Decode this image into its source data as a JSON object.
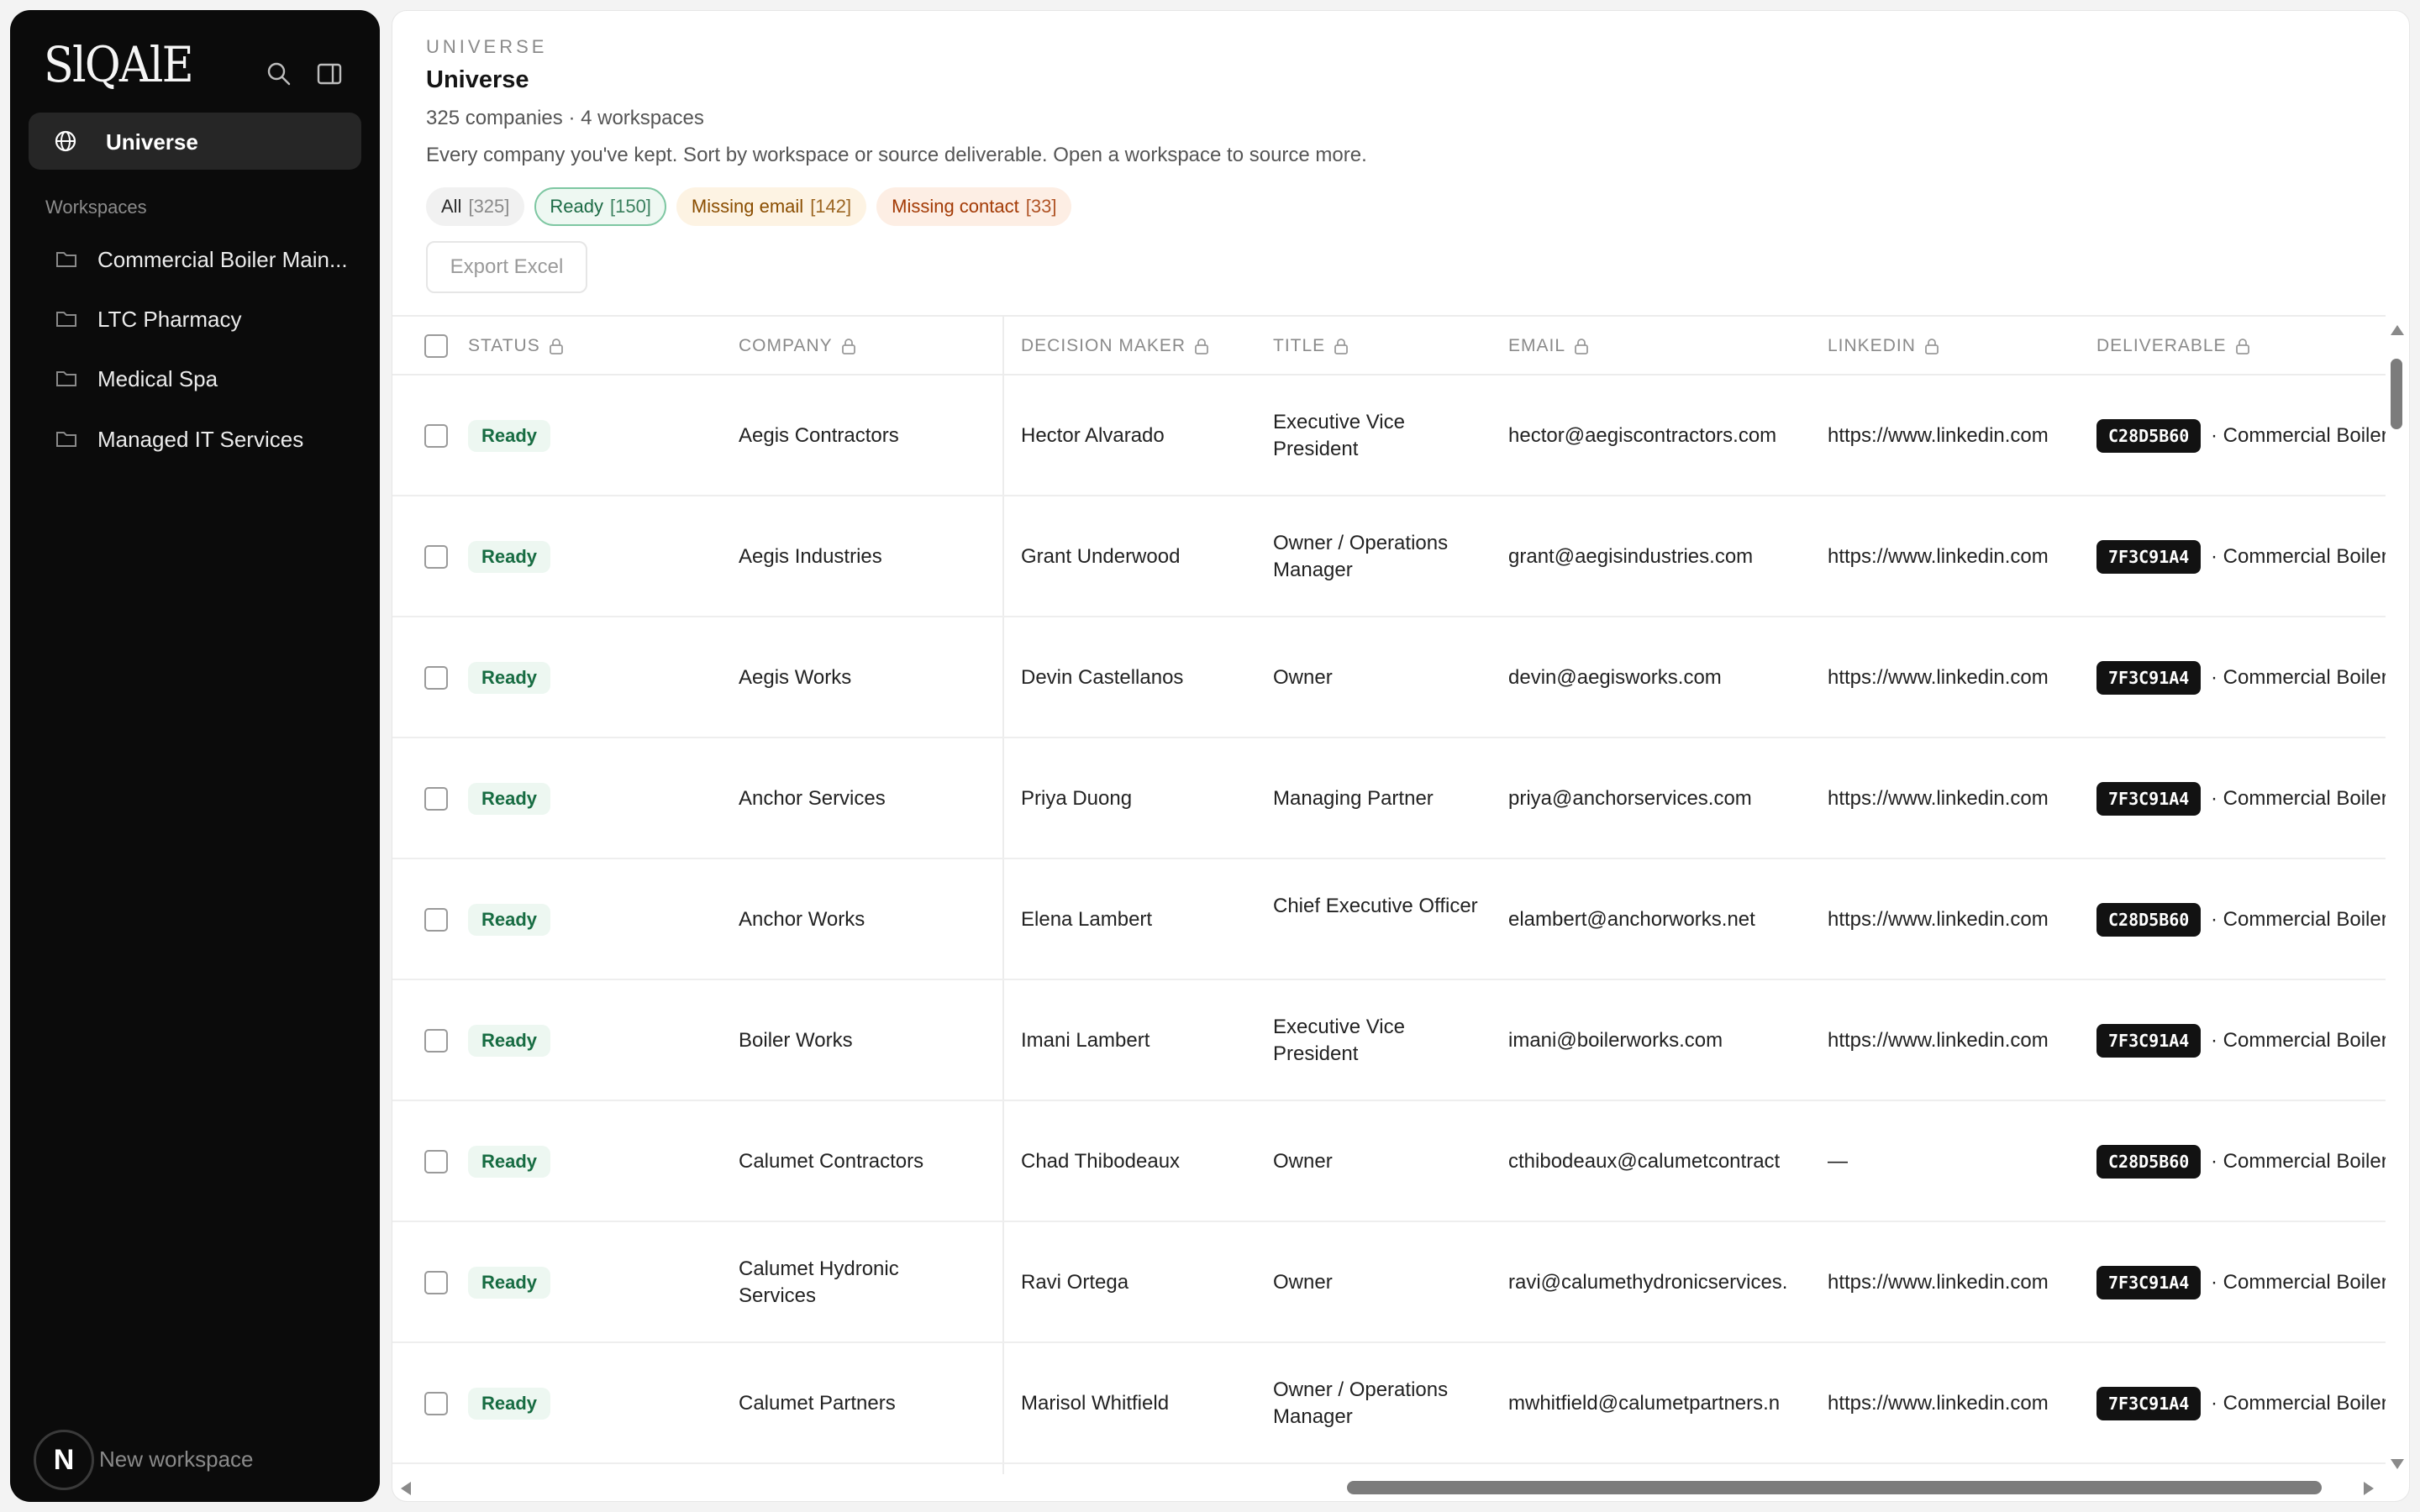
{
  "app": {
    "logo_text": "SlQAlE"
  },
  "sidebar": {
    "search_icon": "search-icon",
    "panel_icon": "sidebar-toggle-icon",
    "universe_label": "Universe",
    "workspaces_heading": "Workspaces",
    "workspaces": [
      {
        "label": "Commercial Boiler Main..."
      },
      {
        "label": "LTC Pharmacy"
      },
      {
        "label": "Medical Spa"
      },
      {
        "label": "Managed IT Services"
      }
    ],
    "new_workspace": "New workspace",
    "avatar_initial": "N"
  },
  "header": {
    "eyebrow": "UNIVERSE",
    "title": "Universe",
    "meta": "325 companies · 4 workspaces",
    "description": "Every company you've kept. Sort by workspace or source deliverable. Open a workspace to source more.",
    "filters": [
      {
        "label": "All",
        "count": "[325]"
      },
      {
        "label": "Ready",
        "count": "[150]"
      },
      {
        "label": "Missing email",
        "count": "[142]"
      },
      {
        "label": "Missing contact",
        "count": "[33]"
      }
    ],
    "export_label": "Export Excel"
  },
  "table": {
    "columns": [
      "STATUS",
      "COMPANY",
      "DECISION MAKER",
      "TITLE",
      "EMAIL",
      "LINKEDIN",
      "DELIVERABLE"
    ],
    "rows": [
      {
        "status": "Ready",
        "company": "Aegis Contractors",
        "decision_maker": "Hector Alvarado",
        "title": "Executive Vice President",
        "email": "hector@aegiscontractors.com",
        "linkedin": "https://www.linkedin.com",
        "code": "C28D5B60",
        "deliverable": "· Commercial Boiler"
      },
      {
        "status": "Ready",
        "company": "Aegis Industries",
        "decision_maker": "Grant Underwood",
        "title": "Owner / Operations Manager",
        "email": "grant@aegisindustries.com",
        "linkedin": "https://www.linkedin.com",
        "code": "7F3C91A4",
        "deliverable": "· Commercial Boiler"
      },
      {
        "status": "Ready",
        "company": "Aegis Works",
        "decision_maker": "Devin Castellanos",
        "title": "Owner",
        "email": "devin@aegisworks.com",
        "linkedin": "https://www.linkedin.com",
        "code": "7F3C91A4",
        "deliverable": "· Commercial Boiler"
      },
      {
        "status": "Ready",
        "company": "Anchor Services",
        "decision_maker": "Priya Duong",
        "title": "Managing Partner",
        "email": "priya@anchorservices.com",
        "linkedin": "https://www.linkedin.com",
        "code": "7F3C91A4",
        "deliverable": "· Commercial Boiler"
      },
      {
        "status": "Ready",
        "company": "Anchor Works",
        "decision_maker": "Elena Lambert",
        "title": "Chief Executive Officer",
        "email": "elambert@anchorworks.net",
        "linkedin": "https://www.linkedin.com",
        "code": "C28D5B60",
        "deliverable": "· Commercial Boiler"
      },
      {
        "status": "Ready",
        "company": "Boiler Works",
        "decision_maker": "Imani Lambert",
        "title": "Executive Vice President",
        "email": "imani@boilerworks.com",
        "linkedin": "https://www.linkedin.com",
        "code": "7F3C91A4",
        "deliverable": "· Commercial Boiler"
      },
      {
        "status": "Ready",
        "company": "Calumet Contractors",
        "decision_maker": "Chad Thibodeaux",
        "title": "Owner",
        "email": "cthibodeaux@calumetcontract",
        "linkedin": "—",
        "code": "C28D5B60",
        "deliverable": "· Commercial Boiler"
      },
      {
        "status": "Ready",
        "company": "Calumet Hydronic Services",
        "decision_maker": "Ravi Ortega",
        "title": "Owner",
        "email": "ravi@calumethydronicservices.",
        "linkedin": "https://www.linkedin.com",
        "code": "7F3C91A4",
        "deliverable": "· Commercial Boiler"
      },
      {
        "status": "Ready",
        "company": "Calumet Partners",
        "decision_maker": "Marisol Whitfield",
        "title": "Owner / Operations Manager",
        "email": "mwhitfield@calumetpartners.n",
        "linkedin": "https://www.linkedin.com",
        "code": "7F3C91A4",
        "deliverable": "· Commercial Boiler"
      }
    ]
  },
  "colors": {
    "sidebar_bg": "#0b0b0b",
    "ready_green": "#176c42",
    "missing_email": "#8a4d00",
    "missing_contact": "#a33a05"
  }
}
